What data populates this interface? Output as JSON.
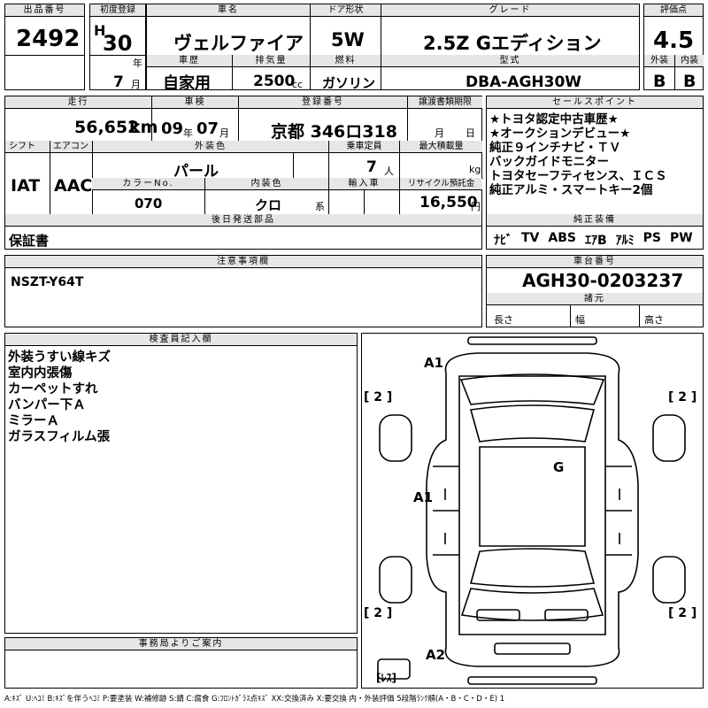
{
  "headers": {
    "lot": "出品番号",
    "first_reg": "初度登録",
    "car_name": "車名",
    "door_type": "ドア形状",
    "grade": "グレード",
    "score": "評価点",
    "exterior": "外装",
    "interior": "内装",
    "history": "車歴",
    "displacement": "排気量",
    "fuel": "燃料",
    "model_code": "型式",
    "mileage": "走行",
    "inspection": "車検",
    "plate": "登録番号",
    "transfer_docs": "譲渡書類期限",
    "sales_points": "セールスポイント",
    "shift": "シフト",
    "aircon": "エアコン",
    "ext_color": "外装色",
    "capacity": "乗車定員",
    "max_load": "最大積載量",
    "color_no": "カラーNo.",
    "int_color": "内装色",
    "import": "輸入車",
    "recycle": "リサイクル預託金",
    "later_parts": "後日発送部品",
    "genuine_equip": "純正装備",
    "notes": "注意事項欄",
    "chassis_no": "車台番号",
    "specs": "諸元",
    "inspector": "検査員記入欄",
    "office": "事務局よりご案内"
  },
  "vehicle": {
    "lot_number": "2492",
    "era": "H",
    "year": "30",
    "year_unit": "年",
    "month": "7",
    "month_unit": "月",
    "name": "ヴェルファイア",
    "doors": "5W",
    "grade": "2.5Z Gエディション",
    "score": "4.5",
    "exterior_score": "B",
    "interior_score": "B",
    "history": "自家用",
    "displacement": "2500",
    "cc": "cc",
    "fuel": "ガソリン",
    "model_code": "DBA-AGH30W",
    "mileage": "56,652",
    "km": "km",
    "inspection_year": "09",
    "inspection_month": "07",
    "ins_year_unit": "年",
    "ins_month_unit": "月",
    "plate": "京都 346ロ318",
    "transfer_month": "月",
    "transfer_day": "日",
    "shift": "IAT",
    "aircon": "AAC",
    "ext_color": "パール",
    "capacity": "7",
    "persons": "人",
    "kg": "kg",
    "color_no": "070",
    "int_color": "クロ",
    "int_suffix": "系",
    "recycle": "16,550",
    "yen": "円",
    "later_parts": "保証書",
    "notes": "NSZT-Y64T",
    "chassis_no": "AGH30-0203237",
    "length_label": "長さ",
    "width_label": "幅",
    "height_label": "高さ"
  },
  "sales_points": [
    "★トヨタ認定中古車歴★",
    "★オークションデビュー★",
    "純正９インチナビ・ＴＶ",
    "バックガイドモニター",
    "トヨタセーフティセンス、ＩＣＳ",
    "純正アルミ・スマートキー2個"
  ],
  "equipment": [
    "ﾅﾋﾞ",
    "TV",
    "ABS",
    "ｴｱB",
    "ｱﾙﾐ",
    "PS",
    "PW"
  ],
  "inspector_notes": [
    "外装うすい線キズ",
    "室内内張傷",
    "カーペットすれ",
    "バンパー下Ａ",
    "ミラーＡ",
    "ガラスフィルム張"
  ],
  "diagram": {
    "front_top": "A1",
    "left_side": "A1",
    "glass": "G",
    "rear": "A2",
    "tire_fl": "[ 2 ]",
    "tire_fr": "[ 2 ]",
    "tire_rl": "[ 2 ]",
    "tire_rr": "[ 2 ]",
    "spare": "[ﾚｽ]"
  },
  "legend": "A:ｷｽﾞ U:ﾍｺﾐ B:ｷｽﾞを伴うﾍｺﾐ P:要塗装 W:補修跡 S:錆 C:腐食 G:ﾌﾛﾝﾄｶﾞﾗｽ点ｷｽﾞ XX:交換済み X:要交換 内・外装評価 5段階ﾗﾝｸ順(A・B・C・D・E) 1"
}
